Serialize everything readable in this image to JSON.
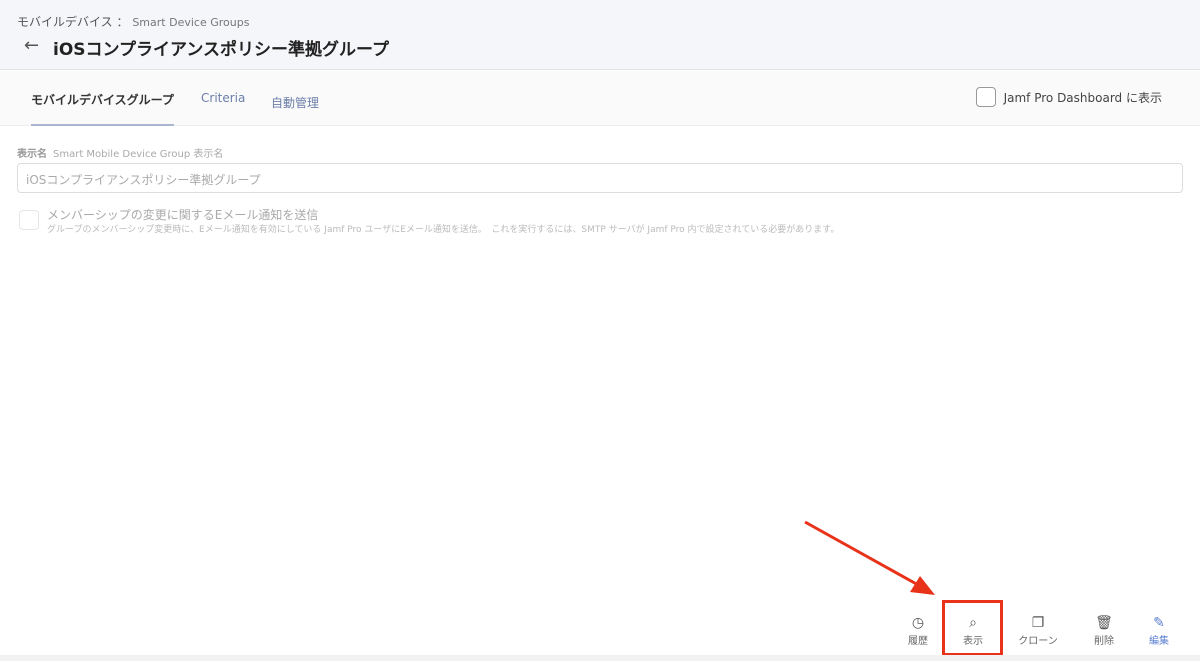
{
  "header": {
    "breadcrumb_main": "モバイルデバイス",
    "breadcrumb_sep": "：",
    "breadcrumb_sub": "Smart Device Groups",
    "title": "iOSコンプライアンスポリシー準拠グループ",
    "back_icon": "←"
  },
  "tabs": [
    {
      "label": "モバイルデバイスグループ",
      "active": true
    },
    {
      "label": "Criteria"
    },
    {
      "label": "自動管理"
    }
  ],
  "dashboard_checkbox": {
    "label": "Jamf Pro Dashboard に表示",
    "checked": false
  },
  "form": {
    "name_label": "表示名",
    "name_hint": "Smart Mobile Device Group 表示名",
    "name_value": "iOSコンプライアンスポリシー準拠グループ",
    "email_label": "メンバーシップの変更に関するEメール通知を送信",
    "email_desc": "グループのメンバーシップ変更時に、Eメール通知を有効にしている Jamf Pro ユーザにEメール通知を送信。　これを実行するには、SMTP サーバが Jamf Pro 内で設定されている必要があります。"
  },
  "actions": [
    {
      "label": "履歴",
      "icon": "history-icon"
    },
    {
      "label": "表示",
      "icon": "view-icon"
    },
    {
      "label": "クローン",
      "icon": "clone-icon"
    },
    {
      "label": "削除",
      "icon": "trash-icon"
    },
    {
      "label": "編集",
      "icon": "edit-icon"
    }
  ],
  "colors": {
    "highlight": "#e8321a",
    "accent": "#5b7fd0"
  }
}
